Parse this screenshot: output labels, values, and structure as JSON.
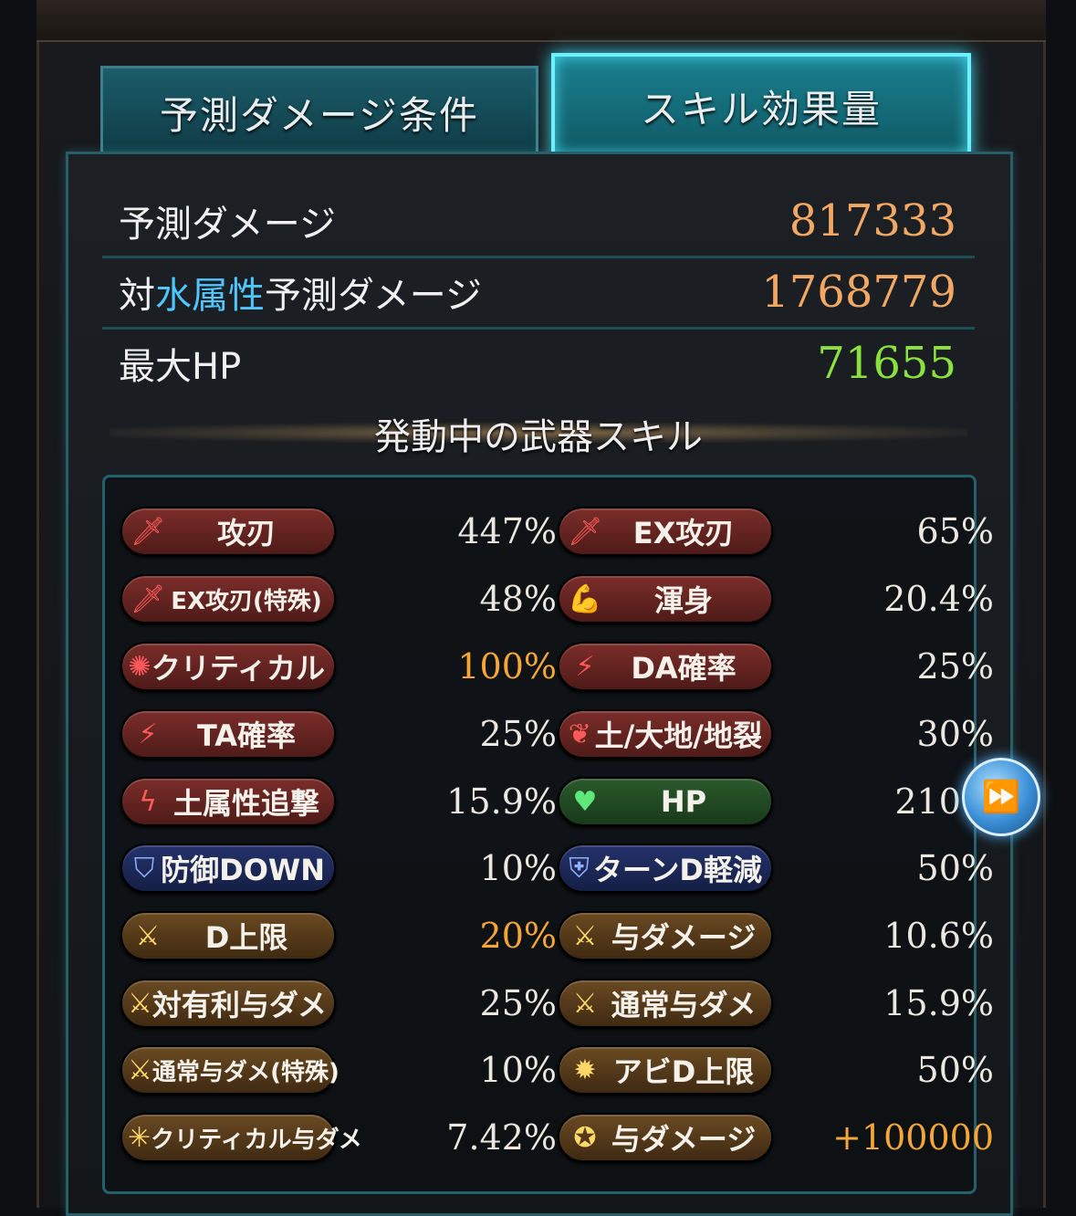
{
  "tabs": {
    "conditions": "予測ダメージ条件",
    "skill_effects": "スキル効果量"
  },
  "stats": {
    "predicted_damage": {
      "label": "予測ダメージ",
      "value": "817333"
    },
    "water_label_prefix": "対",
    "water_label_element": "水属性",
    "water_label_suffix": "予測ダメージ",
    "water_damage_value": "1768779",
    "max_hp": {
      "label": "最大HP",
      "value": "71655"
    }
  },
  "section_title": "発動中の武器スキル",
  "skills": [
    {
      "label": "攻刃",
      "value": "447%",
      "icon": "sword-icon"
    },
    {
      "label": "EX攻刃",
      "value": "65%",
      "icon": "sword-icon"
    },
    {
      "label": "EX攻刃(特殊)",
      "value": "48%",
      "icon": "sword-icon"
    },
    {
      "label": "渾身",
      "value": "20.4%",
      "icon": "flex-arm-icon"
    },
    {
      "label": "クリティカル",
      "value": "100%",
      "icon": "burst-icon"
    },
    {
      "label": "DA確率",
      "value": "25%",
      "icon": "double-strike-icon"
    },
    {
      "label": "TA確率",
      "value": "25%",
      "icon": "triple-strike-icon"
    },
    {
      "label": "土/大地/地裂",
      "value": "30%",
      "icon": "feather-icon"
    },
    {
      "label": "土属性追撃",
      "value": "15.9%",
      "icon": "lightning-icon"
    },
    {
      "label": "HP",
      "value": "210%",
      "icon": "heart-icon"
    },
    {
      "label": "防御DOWN",
      "value": "10%",
      "icon": "broken-shield-icon"
    },
    {
      "label": "ターンD軽減",
      "value": "50%",
      "icon": "shield-icon"
    },
    {
      "label": "D上限",
      "value": "20%",
      "icon": "sword-burst-icon"
    },
    {
      "label": "与ダメージ",
      "value": "10.6%",
      "icon": "sword-burst-icon"
    },
    {
      "label": "対有利与ダメ",
      "value": "25%",
      "icon": "sword-burst-icon"
    },
    {
      "label": "通常与ダメ",
      "value": "15.9%",
      "icon": "sword-burst-icon"
    },
    {
      "label": "通常与ダメ(特殊)",
      "value": "10%",
      "icon": "sword-burst-icon"
    },
    {
      "label": "アビD上限",
      "value": "50%",
      "icon": "gear-burst-icon"
    },
    {
      "label": "クリティカル与ダメ",
      "value": "7.42%",
      "icon": "sparkle-icon"
    },
    {
      "label": "与ダメージ",
      "value": "+100000",
      "icon": "ring-icon"
    }
  ],
  "next_button_icon": "fast-forward-icon"
}
